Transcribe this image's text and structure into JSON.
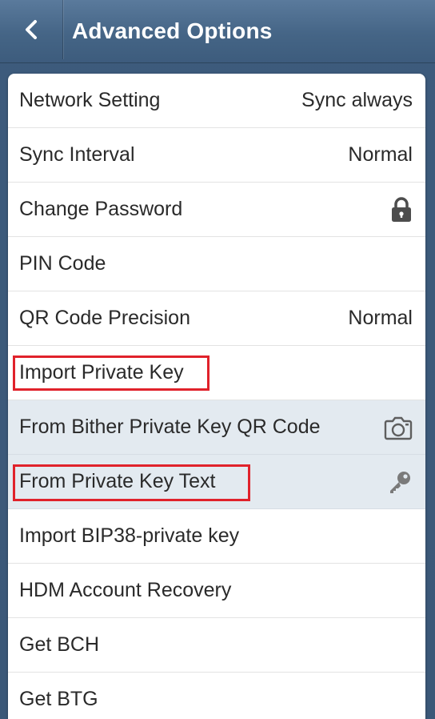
{
  "header": {
    "title": "Advanced Options",
    "back_icon": "chevron-left-icon"
  },
  "settings": {
    "network_setting": {
      "label": "Network Setting",
      "value": "Sync always"
    },
    "sync_interval": {
      "label": "Sync Interval",
      "value": "Normal"
    },
    "change_password": {
      "label": "Change Password",
      "icon": "lock-icon"
    },
    "pin_code": {
      "label": "PIN Code"
    },
    "qr_code_precision": {
      "label": "QR Code Precision",
      "value": "Normal"
    },
    "import_private_key": {
      "label": "Import Private Key"
    },
    "from_bither_qr": {
      "label": "From Bither Private Key QR Code",
      "icon": "camera-icon"
    },
    "from_private_key_text": {
      "label": "From Private Key Text",
      "icon": "key-icon"
    },
    "import_bip38": {
      "label": "Import BIP38-private key"
    },
    "hdm_recovery": {
      "label": "HDM Account Recovery"
    },
    "get_bch": {
      "label": "Get BCH"
    },
    "get_btg": {
      "label": "Get BTG"
    }
  },
  "colors": {
    "header": "#456586",
    "background": "#3d5b7c",
    "sub_row": "#e3eaf0",
    "highlight": "#e0222b",
    "text": "#2a2a2a"
  }
}
